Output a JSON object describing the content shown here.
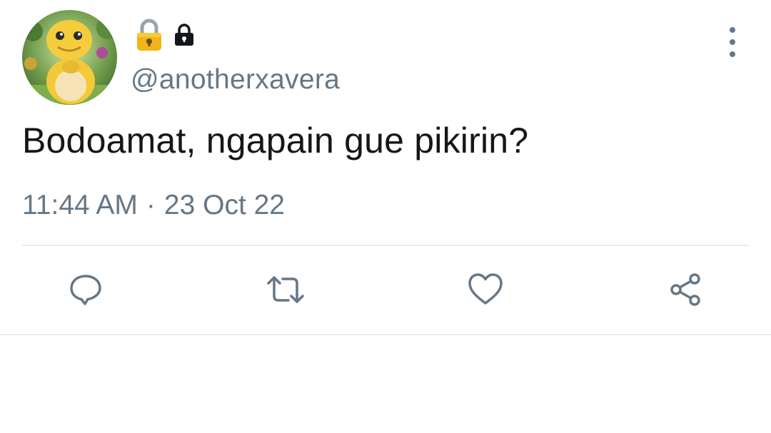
{
  "tweet": {
    "name_icons": [
      "lock-emoji-icon",
      "lock-icon"
    ],
    "handle": "@anotherxavera",
    "text": "Bodoamat, ngapain gue pikirin?",
    "time": "11:44 AM",
    "separator": "·",
    "date": "23 Oct 22"
  },
  "actions": [
    "reply-icon",
    "retweet-icon",
    "like-icon",
    "share-icon"
  ],
  "colors": {
    "text": "#14171a",
    "secondary": "#657786",
    "divider": "#e6ecf0",
    "background": "#ffffff"
  }
}
